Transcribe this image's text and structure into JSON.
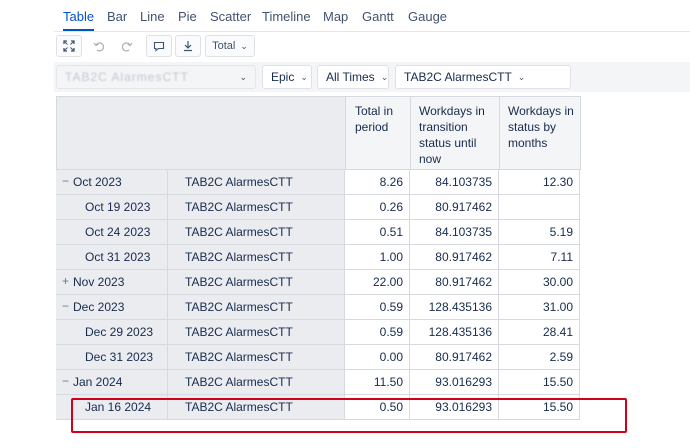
{
  "tabs": [
    {
      "label": "Table",
      "active": true
    },
    {
      "label": "Bar"
    },
    {
      "label": "Line"
    },
    {
      "label": "Pie"
    },
    {
      "label": "Scatter"
    },
    {
      "label": "Timeline"
    },
    {
      "label": "Map"
    },
    {
      "label": "Gantt"
    },
    {
      "label": "Gauge"
    }
  ],
  "toolbar": {
    "total_label": "Total",
    "icons": [
      "fullscreen-icon",
      "undo-icon",
      "redo-icon",
      "comment-icon",
      "download-icon"
    ]
  },
  "filters": {
    "first_chip": "TAB2C AlarmesCTT",
    "epic_label": "Epic",
    "times_label": "All Times",
    "issue_label": "TAB2C AlarmesCTT"
  },
  "table": {
    "headers": [
      "Total in period",
      "Workdays in transition status until now",
      "Workdays in status by months"
    ],
    "rows": [
      {
        "period": "Oct 2023",
        "issue": "TAB2C AlarmesCTT",
        "total": "8.26",
        "until_now": "84.103735",
        "by_months": "12.30",
        "level": 0,
        "expander": "−"
      },
      {
        "period": "Oct 19 2023",
        "issue": "TAB2C AlarmesCTT",
        "total": "0.26",
        "until_now": "80.917462",
        "by_months": "",
        "level": 1
      },
      {
        "period": "Oct 24 2023",
        "issue": "TAB2C AlarmesCTT",
        "total": "0.51",
        "until_now": "84.103735",
        "by_months": "5.19",
        "level": 1
      },
      {
        "period": "Oct 31 2023",
        "issue": "TAB2C AlarmesCTT",
        "total": "1.00",
        "until_now": "80.917462",
        "by_months": "7.11",
        "level": 1
      },
      {
        "period": "Nov 2023",
        "issue": "TAB2C AlarmesCTT",
        "total": "22.00",
        "until_now": "80.917462",
        "by_months": "30.00",
        "level": 0,
        "expander": "+"
      },
      {
        "period": "Dec 2023",
        "issue": "TAB2C AlarmesCTT",
        "total": "0.59",
        "until_now": "128.435136",
        "by_months": "31.00",
        "level": 0,
        "expander": "−"
      },
      {
        "period": "Dec 29 2023",
        "issue": "TAB2C AlarmesCTT",
        "total": "0.59",
        "until_now": "128.435136",
        "by_months": "28.41",
        "level": 1
      },
      {
        "period": "Dec 31 2023",
        "issue": "TAB2C AlarmesCTT",
        "total": "0.00",
        "until_now": "80.917462",
        "by_months": "2.59",
        "level": 1
      },
      {
        "period": "Jan 2024",
        "issue": "TAB2C AlarmesCTT",
        "total": "11.50",
        "until_now": "93.016293",
        "by_months": "15.50",
        "level": 0,
        "expander": "−"
      },
      {
        "period": "Jan 16 2024",
        "issue": "TAB2C AlarmesCTT",
        "total": "0.50",
        "until_now": "93.016293",
        "by_months": "15.50",
        "level": 1
      }
    ]
  },
  "colors": {
    "accent": "#0052cc",
    "highlight": "#d0021b"
  }
}
